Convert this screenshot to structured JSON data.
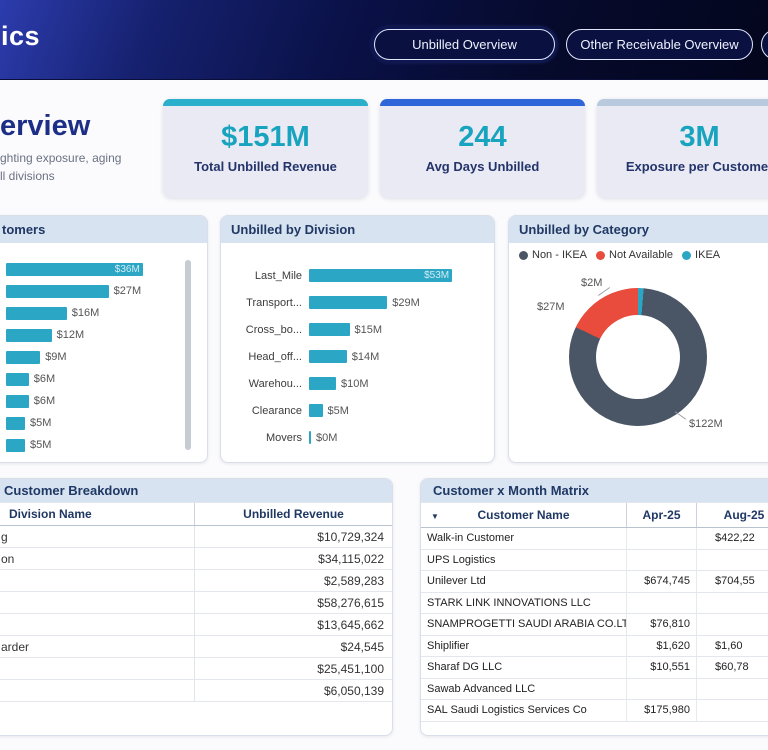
{
  "navbar": {
    "brand_fragment": "ics",
    "tabs": [
      {
        "label": "Unbilled Overview",
        "active": true
      },
      {
        "label": "Other Receivable Overview",
        "active": false
      }
    ]
  },
  "header": {
    "title_fragment": "erview",
    "subtitle_line1": "ghting exposure, aging",
    "subtitle_line2": "ll divisions"
  },
  "kpis": [
    {
      "value": "$151M",
      "label": "Total Unbilled Revenue",
      "accent": "#2bb0cb"
    },
    {
      "value": "244",
      "label": "Avg Days Unbilled",
      "accent": "#2e66d9"
    },
    {
      "value": "3M",
      "label": "Exposure per Customer",
      "accent": "#b9c9de"
    }
  ],
  "chart_data": [
    {
      "type": "bar",
      "orientation": "horizontal",
      "title_fragment": "tomers",
      "values": [
        36,
        27,
        16,
        12,
        9,
        6,
        6,
        5,
        5
      ],
      "value_labels": [
        "$36M",
        "$27M",
        "$16M",
        "$12M",
        "$9M",
        "$6M",
        "$6M",
        "$5M",
        "$5M"
      ],
      "inside_label_index": 0,
      "bar_color": "#2ba6c4"
    },
    {
      "type": "bar",
      "orientation": "horizontal",
      "title": "Unbilled by Division",
      "categories": [
        "Last_Mile",
        "Transport...",
        "Cross_bo...",
        "Head_off...",
        "Warehou...",
        "Clearance",
        "Movers"
      ],
      "values": [
        53,
        29,
        15,
        14,
        10,
        5,
        0
      ],
      "value_labels": [
        "$53M",
        "$29M",
        "$15M",
        "$14M",
        "$10M",
        "$5M",
        "$0M"
      ],
      "inside_label_index": 0,
      "bar_color": "#2ba6c4"
    },
    {
      "type": "donut",
      "title": "Unbilled by Category",
      "slices": [
        {
          "name": "IKEA",
          "value": 2,
          "label": "$2M",
          "color": "#2ba6c4"
        },
        {
          "name": "Non - IKEA",
          "value": 122,
          "label": "$122M",
          "color": "#4a5565"
        },
        {
          "name": "Not Available",
          "value": 27,
          "label": "$27M",
          "color": "#e94b3c"
        }
      ],
      "legend": [
        {
          "label": "Non - IKEA",
          "color": "#4a5565"
        },
        {
          "label": "Not Available",
          "color": "#e94b3c"
        },
        {
          "label": "IKEA",
          "color": "#2ba6c4"
        }
      ]
    }
  ],
  "tables": {
    "breakdown": {
      "title_fragment": "Customer Breakdown",
      "columns": [
        "Division Name",
        "Unbilled Revenue"
      ],
      "rows": [
        [
          "g",
          "$10,729,324"
        ],
        [
          "on",
          "$34,115,022"
        ],
        [
          "",
          "$2,589,283"
        ],
        [
          "",
          "$58,276,615"
        ],
        [
          "",
          "$13,645,662"
        ],
        [
          "arder",
          "$24,545"
        ],
        [
          "",
          "$25,451,100"
        ],
        [
          "",
          "$6,050,139"
        ]
      ]
    },
    "matrix": {
      "title": "Customer x Month Matrix",
      "sort_icon": "▼",
      "columns": [
        "Customer Name",
        "Apr-25",
        "Aug-25"
      ],
      "rows": [
        [
          "Walk-in Customer",
          "",
          "$422,22"
        ],
        [
          "UPS Logistics",
          "",
          ""
        ],
        [
          "Unilever Ltd",
          "$674,745",
          "$704,55"
        ],
        [
          "STARK LINK INNOVATIONS LLC",
          "",
          ""
        ],
        [
          "SNAMPROGETTI SAUDI ARABIA CO.LTD",
          "$76,810",
          ""
        ],
        [
          "Shiplifier",
          "$1,620",
          "$1,60"
        ],
        [
          "Sharaf DG LLC",
          "$10,551",
          "$60,78"
        ],
        [
          "Sawab Advanced LLC",
          "",
          ""
        ],
        [
          "SAL Saudi Logistics Services Co",
          "$175,980",
          ""
        ]
      ]
    }
  }
}
